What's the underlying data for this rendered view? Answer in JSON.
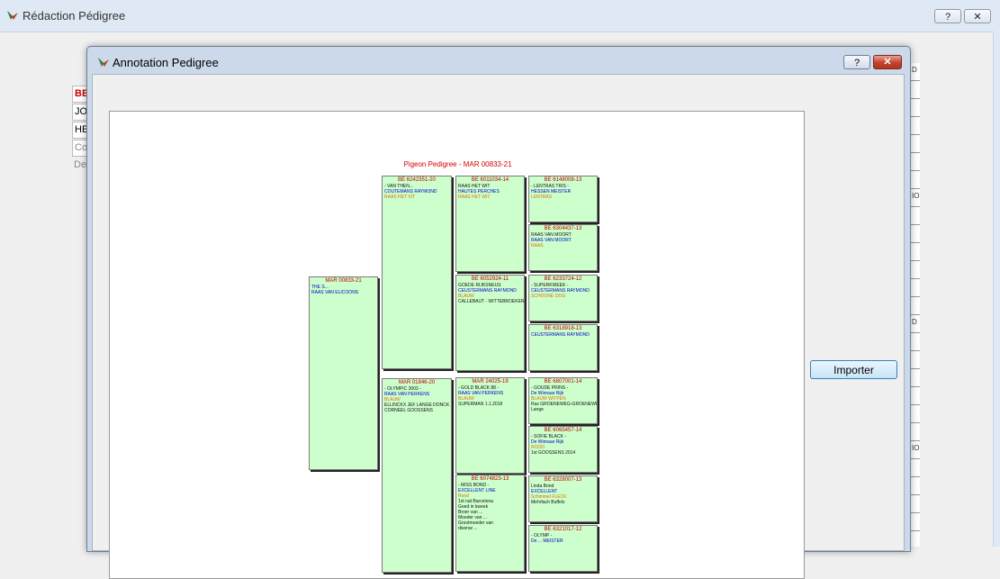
{
  "outer_window": {
    "title": "Rédaction Pédigree",
    "help_label": "?",
    "close_label": "✕",
    "bg_cells": [
      "BE",
      "JO",
      "HE",
      "Co",
      "De"
    ],
    "right_grid_labels": [
      "D",
      "IO",
      "D",
      "IO"
    ]
  },
  "dialog": {
    "title": "Annotation Pedigree",
    "help_label": "?",
    "close_label": "✕",
    "import_button": "Importer"
  },
  "pedigree": {
    "title": "Pigeon Pedigree - MAR 00833-21",
    "colors": {
      "box_fill": "#ccffcc",
      "id_text": "#c00000",
      "title": "#d40000"
    },
    "subject": {
      "id": "MAR 00833-21",
      "lines": [
        {
          "t": "THE S...",
          "c": "blue"
        },
        {
          "t": "RAAS VAN ELICOONS",
          "c": "blue"
        }
      ]
    },
    "parents": [
      {
        "id": "BE 6242351-20",
        "lines": [
          {
            "t": "- VAN THEN...",
            "c": "black"
          },
          {
            "t": "COUTEMANS RAYMOND",
            "c": "blue"
          },
          {
            "t": "RAAS HET VIT",
            "c": "orange"
          }
        ]
      },
      {
        "id": "MAR 01846-20",
        "lines": [
          {
            "t": "- OLYMPIC 3003 -",
            "c": "black"
          },
          {
            "t": "RAAS VAN PERKENS",
            "c": "blue"
          },
          {
            "t": "BLAUW",
            "c": "orange"
          },
          {
            "t": "ELLINCKX JEF LANGE DONCK",
            "c": "black"
          },
          {
            "t": "CORNEEL GOOSSENS",
            "c": "black"
          }
        ]
      }
    ],
    "grandparents": [
      {
        "id": "BE 6011034-14",
        "lines": [
          {
            "t": "RAAS HET WIT",
            "c": "black"
          },
          {
            "t": "HAUTES PERCHES",
            "c": "blue"
          },
          {
            "t": "RAAS HET WIT",
            "c": "orange"
          }
        ]
      },
      {
        "id": "BE 6052924-11",
        "lines": [
          {
            "t": "GOEDE RIJKSNEUS",
            "c": "black"
          },
          {
            "t": "CEUSTERMANS RAYMOND",
            "c": "blue"
          },
          {
            "t": "BLAUW",
            "c": "orange"
          },
          {
            "t": "CALLEBAUT - WITTEBROEKEN",
            "c": "black"
          }
        ]
      },
      {
        "id": "MAR 24025-19",
        "lines": [
          {
            "t": "- GOLD BLACK 88 -",
            "c": "black"
          },
          {
            "t": "RAAS VAN PERKENS",
            "c": "blue"
          },
          {
            "t": "BLAUW",
            "c": "orange"
          },
          {
            "t": "SUPERMAN 1.1.2018",
            "c": "black"
          }
        ]
      },
      {
        "id": "BE 6074823-13",
        "lines": [
          {
            "t": "- MISS BOND -",
            "c": "black"
          },
          {
            "t": "EXCELLENT LINE",
            "c": "blue"
          },
          {
            "t": "Rood",
            "c": "orange"
          },
          {
            "t": "1st nat Barcelona",
            "c": "black"
          },
          {
            "t": "Goed in kweek",
            "c": "black"
          },
          {
            "t": "Broer van ...",
            "c": "black"
          },
          {
            "t": "Moeder van ...",
            "c": "black"
          },
          {
            "t": "Grootmoeder van",
            "c": "black"
          },
          {
            "t": "diverse ...",
            "c": "black"
          }
        ]
      }
    ],
    "great_grandparents": [
      {
        "id": "BE 6148008-13",
        "lines": [
          {
            "t": "- LENTRAS TRIS -",
            "c": "black"
          },
          {
            "t": "HESSEN MEISTER",
            "c": "blue"
          },
          {
            "t": "LENTRAS",
            "c": "orange"
          }
        ]
      },
      {
        "id": "BE 6304437-13",
        "lines": [
          {
            "t": "RAAS VAN MOORT",
            "c": "black"
          },
          {
            "t": "RAAS VAN MOORT",
            "c": "blue"
          },
          {
            "t": "RAAS",
            "c": "orange"
          }
        ]
      },
      {
        "id": "BE 6233724-12",
        "lines": [
          {
            "t": "- SUPERKWEEK -",
            "c": "black"
          },
          {
            "t": "CEUSTERMANS RAYMOND",
            "c": "blue"
          },
          {
            "t": "SCHOONE OOG",
            "c": "orange"
          }
        ]
      },
      {
        "id": "BE 6318918-13",
        "lines": [
          {
            "t": "CEUSTERMANS RAYMOND",
            "c": "blue"
          }
        ]
      },
      {
        "id": "BE 6807001-14",
        "lines": [
          {
            "t": "- GOUDE PRINS -",
            "c": "black"
          },
          {
            "t": "De Winnaar Rijk",
            "c": "blue"
          },
          {
            "t": "BLAUW WITPEN",
            "c": "orange"
          },
          {
            "t": "Ras GROENEWEG-GROENEWEG",
            "c": "black"
          },
          {
            "t": "Lange",
            "c": "black"
          }
        ]
      },
      {
        "id": "BE 6065457-14",
        "lines": [
          {
            "t": "- SOFIE BLACK -",
            "c": "black"
          },
          {
            "t": "De Winnaar Rijk",
            "c": "blue"
          },
          {
            "t": "ROOD",
            "c": "orange"
          },
          {
            "t": "1st GOOSSENS 2014",
            "c": "black"
          }
        ]
      },
      {
        "id": "BE 6328007-13",
        "lines": [
          {
            "t": "Linda Bond",
            "c": "black"
          },
          {
            "t": "EXCELLENT",
            "c": "blue"
          },
          {
            "t": "Schimmel FLECK",
            "c": "orange"
          },
          {
            "t": "Mehrfach Buffels",
            "c": "black"
          }
        ]
      },
      {
        "id": "BE 6321017-12",
        "lines": [
          {
            "t": "- OLYMP -",
            "c": "black"
          },
          {
            "t": "De ... MEISTER",
            "c": "blue"
          }
        ]
      }
    ]
  }
}
